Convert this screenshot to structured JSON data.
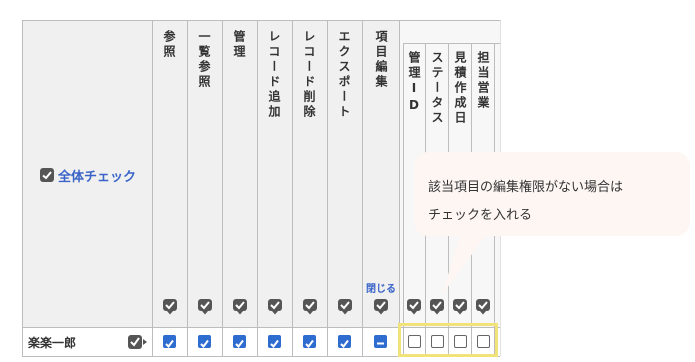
{
  "header": {
    "select_all_label": "全体チェック",
    "columns": [
      "参照",
      "一覧参照",
      "管理",
      "レコード追加",
      "レコード削除",
      "エクスポート"
    ],
    "item_edit_label": "項目編集",
    "close_label": "閉じる",
    "sub_columns": [
      "管理ID",
      "ステータス",
      "見積作成日",
      "担当営業"
    ]
  },
  "rows": [
    {
      "user_name": "楽楽一郎"
    }
  ],
  "tooltip": {
    "line1": "該当項目の編集権限がない場合は",
    "line2": "チェックを入れる"
  },
  "colors": {
    "accent_blue": "#2f6ccf",
    "link_blue": "#3a64c8",
    "highlight_yellow": "#f2e27a",
    "tooltip_bg": "#fdf6f3"
  }
}
